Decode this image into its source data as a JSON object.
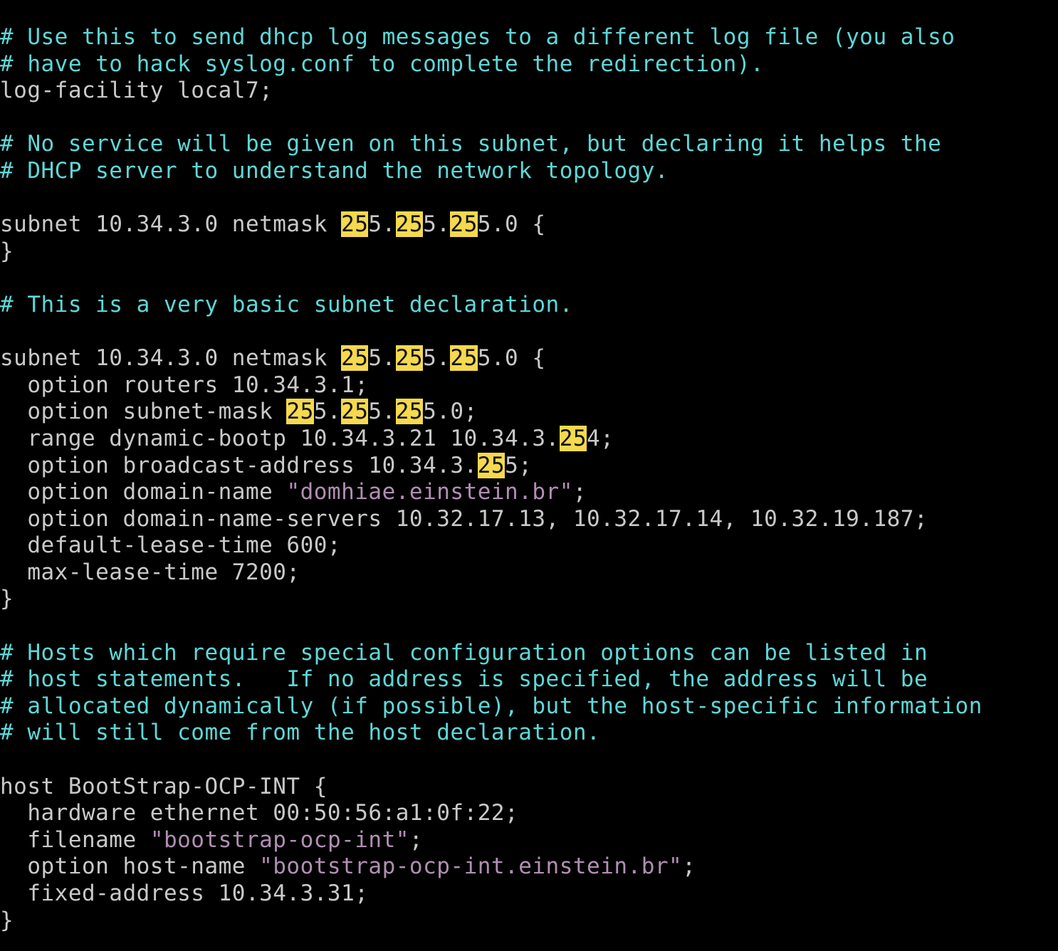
{
  "colors": {
    "background": "#000000",
    "comment": "#5fd7d7",
    "code": "#c9c9c9",
    "string": "#b08fb2",
    "search_highlight": "#f5d94e"
  },
  "lines": [
    [
      {
        "t": "comment",
        "text": "# Use this to send dhcp log messages to a different log file (you also"
      }
    ],
    [
      {
        "t": "comment",
        "text": "# have to hack syslog.conf to complete the redirection)."
      }
    ],
    [
      {
        "t": "code",
        "text": "log-facility local7;"
      }
    ],
    [],
    [
      {
        "t": "comment",
        "text": "# No service will be given on this subnet, but declaring it helps the"
      }
    ],
    [
      {
        "t": "comment",
        "text": "# DHCP server to understand the network topology."
      }
    ],
    [],
    [
      {
        "t": "code",
        "text": "subnet 10.34.3.0 netmask "
      },
      {
        "t": "hl",
        "text": "25"
      },
      {
        "t": "code",
        "text": "5."
      },
      {
        "t": "hl",
        "text": "25"
      },
      {
        "t": "code",
        "text": "5."
      },
      {
        "t": "hl",
        "text": "25"
      },
      {
        "t": "code",
        "text": "5.0 {"
      }
    ],
    [
      {
        "t": "code",
        "text": "}"
      }
    ],
    [],
    [
      {
        "t": "comment",
        "text": "# This is a very basic subnet declaration."
      }
    ],
    [],
    [
      {
        "t": "code",
        "text": "subnet 10.34.3.0 netmask "
      },
      {
        "t": "hl",
        "text": "25"
      },
      {
        "t": "code",
        "text": "5."
      },
      {
        "t": "hl",
        "text": "25"
      },
      {
        "t": "code",
        "text": "5."
      },
      {
        "t": "hl",
        "text": "25"
      },
      {
        "t": "code",
        "text": "5.0 {"
      }
    ],
    [
      {
        "t": "code",
        "text": "  option routers 10.34.3.1;"
      }
    ],
    [
      {
        "t": "code",
        "text": "  option subnet-mask "
      },
      {
        "t": "hl",
        "text": "25"
      },
      {
        "t": "code",
        "text": "5."
      },
      {
        "t": "hl",
        "text": "25"
      },
      {
        "t": "code",
        "text": "5."
      },
      {
        "t": "hl",
        "text": "25"
      },
      {
        "t": "code",
        "text": "5.0;"
      }
    ],
    [
      {
        "t": "code",
        "text": "  range dynamic-bootp 10.34.3.21 10.34.3."
      },
      {
        "t": "hl",
        "text": "25"
      },
      {
        "t": "code",
        "text": "4;"
      }
    ],
    [
      {
        "t": "code",
        "text": "  option broadcast-address 10.34.3."
      },
      {
        "t": "hl",
        "text": "25"
      },
      {
        "t": "code",
        "text": "5;"
      }
    ],
    [
      {
        "t": "code",
        "text": "  option domain-name "
      },
      {
        "t": "string",
        "text": "\"domhiae.einstein.br\""
      },
      {
        "t": "code",
        "text": ";"
      }
    ],
    [
      {
        "t": "code",
        "text": "  option domain-name-servers 10.32.17.13, 10.32.17.14, 10.32.19.187;"
      }
    ],
    [
      {
        "t": "code",
        "text": "  default-lease-time 600;"
      }
    ],
    [
      {
        "t": "code",
        "text": "  max-lease-time 7200;"
      }
    ],
    [
      {
        "t": "code",
        "text": "}"
      }
    ],
    [],
    [
      {
        "t": "comment",
        "text": "# Hosts which require special configuration options can be listed in"
      }
    ],
    [
      {
        "t": "comment",
        "text": "# host statements.   If no address is specified, the address will be"
      }
    ],
    [
      {
        "t": "comment",
        "text": "# allocated dynamically (if possible), but the host-specific information"
      }
    ],
    [
      {
        "t": "comment",
        "text": "# will still come from the host declaration."
      }
    ],
    [],
    [
      {
        "t": "code",
        "text": "host BootStrap-OCP-INT {"
      }
    ],
    [
      {
        "t": "code",
        "text": "  hardware ethernet 00:50:56:a1:0f:22;"
      }
    ],
    [
      {
        "t": "code",
        "text": "  filename "
      },
      {
        "t": "string",
        "text": "\"bootstrap-ocp-int\""
      },
      {
        "t": "code",
        "text": ";"
      }
    ],
    [
      {
        "t": "code",
        "text": "  option host-name "
      },
      {
        "t": "string",
        "text": "\"bootstrap-ocp-int.einstein.br\""
      },
      {
        "t": "code",
        "text": ";"
      }
    ],
    [
      {
        "t": "code",
        "text": "  fixed-address 10.34.3.31;"
      }
    ],
    [
      {
        "t": "code",
        "text": "}"
      }
    ]
  ]
}
